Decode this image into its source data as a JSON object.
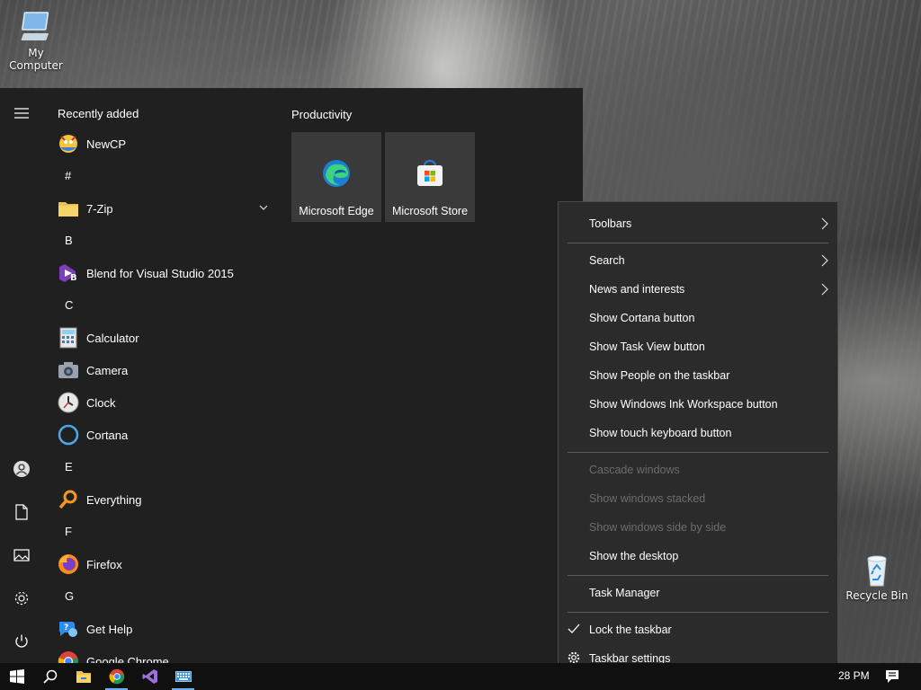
{
  "desktop": {
    "icons": [
      {
        "label": "My Computer",
        "icon": "computer-icon"
      },
      {
        "label": "Recycle Bin",
        "icon": "recycle-bin-icon"
      }
    ]
  },
  "start_menu": {
    "rail": {
      "items": [
        {
          "name": "expand",
          "icon": "hamburger-icon"
        },
        {
          "name": "user",
          "icon": "user-icon"
        },
        {
          "name": "documents",
          "icon": "document-icon"
        },
        {
          "name": "pictures",
          "icon": "pictures-icon"
        },
        {
          "name": "settings",
          "icon": "gear-icon"
        },
        {
          "name": "power",
          "icon": "power-icon"
        }
      ]
    },
    "recently_added_label": "Recently added",
    "tiles_group_label": "Productivity",
    "apps": [
      {
        "type": "app",
        "label": "NewCP",
        "icon": "newcp-icon"
      },
      {
        "type": "letter",
        "label": "#"
      },
      {
        "type": "app",
        "label": "7-Zip",
        "icon": "folder-icon",
        "expandable": true
      },
      {
        "type": "letter",
        "label": "B"
      },
      {
        "type": "app",
        "label": "Blend for Visual Studio 2015",
        "icon": "blend-icon"
      },
      {
        "type": "letter",
        "label": "C"
      },
      {
        "type": "app",
        "label": "Calculator",
        "icon": "calculator-icon"
      },
      {
        "type": "app",
        "label": "Camera",
        "icon": "camera-icon"
      },
      {
        "type": "app",
        "label": "Clock",
        "icon": "clock-icon"
      },
      {
        "type": "app",
        "label": "Cortana",
        "icon": "cortana-icon"
      },
      {
        "type": "letter",
        "label": "E"
      },
      {
        "type": "app",
        "label": "Everything",
        "icon": "search-magnifier-icon"
      },
      {
        "type": "letter",
        "label": "F"
      },
      {
        "type": "app",
        "label": "Firefox",
        "icon": "firefox-icon"
      },
      {
        "type": "letter",
        "label": "G"
      },
      {
        "type": "app",
        "label": "Get Help",
        "icon": "help-icon"
      },
      {
        "type": "app",
        "label": "Google Chrome",
        "icon": "chrome-icon"
      }
    ],
    "tiles": [
      {
        "label": "Microsoft Edge",
        "icon": "edge-icon"
      },
      {
        "label": "Microsoft Store",
        "icon": "store-icon"
      }
    ]
  },
  "context_menu": {
    "items": [
      {
        "label": "Toolbars",
        "submenu": true,
        "enabled": true
      },
      {
        "type": "separator"
      },
      {
        "label": "Search",
        "submenu": true,
        "enabled": true
      },
      {
        "label": "News and interests",
        "submenu": true,
        "enabled": true
      },
      {
        "label": "Show Cortana button",
        "enabled": true
      },
      {
        "label": "Show Task View button",
        "enabled": true
      },
      {
        "label": "Show People on the taskbar",
        "enabled": true
      },
      {
        "label": "Show Windows Ink Workspace button",
        "enabled": true
      },
      {
        "label": "Show touch keyboard button",
        "enabled": true
      },
      {
        "type": "separator"
      },
      {
        "label": "Cascade windows",
        "enabled": false
      },
      {
        "label": "Show windows stacked",
        "enabled": false
      },
      {
        "label": "Show windows side by side",
        "enabled": false
      },
      {
        "label": "Show the desktop",
        "enabled": true
      },
      {
        "type": "separator"
      },
      {
        "label": "Task Manager",
        "enabled": true
      },
      {
        "type": "separator"
      },
      {
        "label": "Lock the taskbar",
        "enabled": true,
        "checked": true,
        "leading_icon": "checkmark-icon"
      },
      {
        "label": "Taskbar settings",
        "enabled": true,
        "leading_icon": "gear-icon"
      }
    ]
  },
  "taskbar": {
    "buttons": [
      {
        "name": "start",
        "icon": "windows-logo-icon",
        "active": false
      },
      {
        "name": "search",
        "icon": "search-icon",
        "active": false
      },
      {
        "name": "file-explorer",
        "icon": "folder-icon",
        "active": false
      },
      {
        "name": "chrome",
        "icon": "chrome-icon",
        "active": true
      },
      {
        "name": "visual-studio",
        "icon": "visual-studio-icon",
        "active": false
      },
      {
        "name": "keyboard",
        "icon": "keyboard-icon",
        "active": true
      }
    ],
    "clock": "28 PM",
    "notification_icon": "action-center-icon"
  },
  "colors": {
    "start_bg": "#202020",
    "menu_bg": "#2b2b2b",
    "taskbar_bg": "#101010",
    "tile_bg": "#3a3a3a",
    "accent": "#6ab0f0"
  }
}
